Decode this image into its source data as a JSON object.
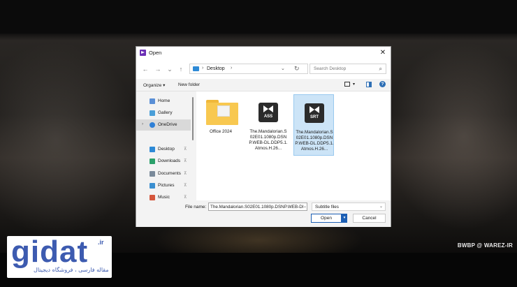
{
  "dialog": {
    "title": "Open",
    "close": "✕"
  },
  "nav": {
    "back": "←",
    "forward": "→",
    "recent": "⌄",
    "up": "↑",
    "address_sep": "›",
    "address": "Desktop",
    "address_dropdown": "⌄",
    "refresh": "↻",
    "search_placeholder": "Search Desktop",
    "search_icon": "⌕"
  },
  "commandbar": {
    "organize": "Organize ▾",
    "new_folder": "New folder"
  },
  "sidebar": {
    "items": [
      {
        "label": "Home",
        "icon": "home-icon",
        "color": "#5a8fd6"
      },
      {
        "label": "Gallery",
        "icon": "gallery-icon",
        "color": "#4a9fd8"
      },
      {
        "label": "OneDrive",
        "icon": "onedrive-icon",
        "color": "#2e7fd6",
        "selected": true,
        "chevron": "›"
      },
      {
        "label": "Desktop",
        "icon": "desktop-icon",
        "color": "#2e8ad6",
        "pin": "📌"
      },
      {
        "label": "Downloads",
        "icon": "downloads-icon",
        "color": "#2aa06a",
        "pin": "📌"
      },
      {
        "label": "Documents",
        "icon": "documents-icon",
        "color": "#7a8a9a",
        "pin": "📌"
      },
      {
        "label": "Pictures",
        "icon": "pictures-icon",
        "color": "#3b8fd0",
        "pin": "📌"
      },
      {
        "label": "Music",
        "icon": "music-icon",
        "color": "#d5563c",
        "pin": "📌"
      }
    ]
  },
  "files": [
    {
      "name": "Office 2024",
      "kind": "folder"
    },
    {
      "name": "The.Mandalorian.S02E01.1080p.DSNP.WEB-DL.DDP5.1.Atmos.H.26...",
      "kind": "ass",
      "tag": "ASS"
    },
    {
      "name": "The.Mandalorian.S02E01.1080p.DSNP.WEB-DL.DDP5.1.Atmos.H.26...",
      "kind": "srt",
      "tag": "SRT",
      "selected": true
    }
  ],
  "footer": {
    "filename_label": "File name:",
    "filename_value": "The.Mandalorian.S02E01.1080p.DSNP.WEB-DI",
    "filetype": "Subtitle files",
    "open": "Open",
    "cancel": "Cancel"
  },
  "overlay": {
    "watermark": "BWBP @ WAREZ-IR",
    "logo_word": "gidat",
    "logo_tld": ".ir",
    "logo_tagline": "مقاله فارسی ، فروشگاه دیجیتال"
  }
}
